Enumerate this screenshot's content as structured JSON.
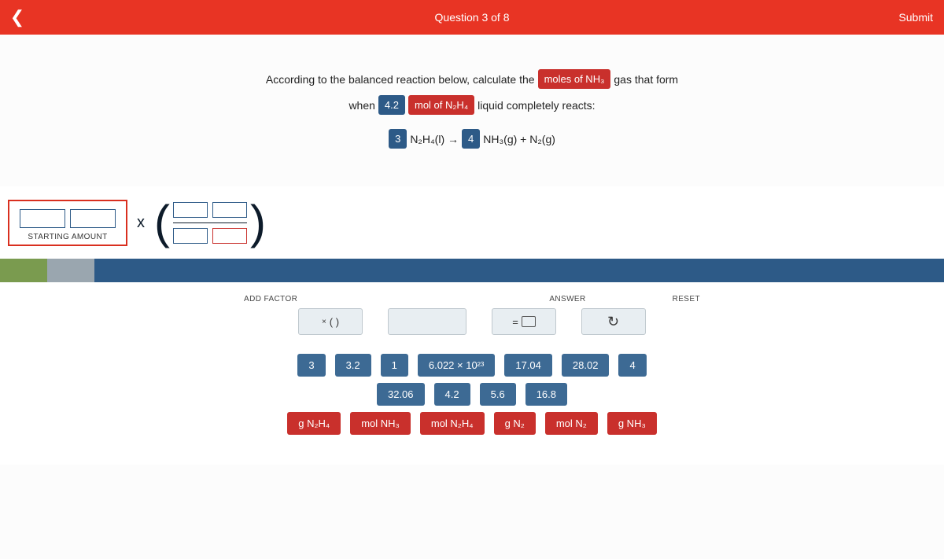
{
  "header": {
    "title": "Question 3 of 8",
    "submit": "Submit"
  },
  "question": {
    "line1_pre": "According to the balanced reaction below, calculate the",
    "line1_tag": "moles of NH₃",
    "line1_post": "gas that form",
    "line2_pre": "when",
    "line2_tag_a": "4.2",
    "line2_tag_b": "mol of N₂H₄",
    "line2_post": "liquid completely reacts:",
    "eq_coef1": "3",
    "eq_r1": "N₂H₄(l)  →",
    "eq_coef2": "4",
    "eq_r2": "NH₃(g) + N₂(g)"
  },
  "workspace": {
    "starting_label": "STARTING AMOUNT",
    "times": "x"
  },
  "controls": {
    "add_factor_label": "ADD FACTOR",
    "answer_label": "ANSWER",
    "reset_label": "RESET",
    "add_factor_btn_prefix": "×",
    "add_factor_btn": "(   )",
    "answer_btn_prefix": "=",
    "reset_icon": "↺"
  },
  "tiles_numbers_row1": [
    "3",
    "3.2",
    "1",
    "6.022 × 10²³",
    "17.04",
    "28.02",
    "4"
  ],
  "tiles_numbers_row2": [
    "32.06",
    "4.2",
    "5.6",
    "16.8"
  ],
  "tiles_units": [
    "g N₂H₄",
    "mol NH₃",
    "mol N₂H₄",
    "g N₂",
    "mol N₂",
    "g NH₃"
  ]
}
